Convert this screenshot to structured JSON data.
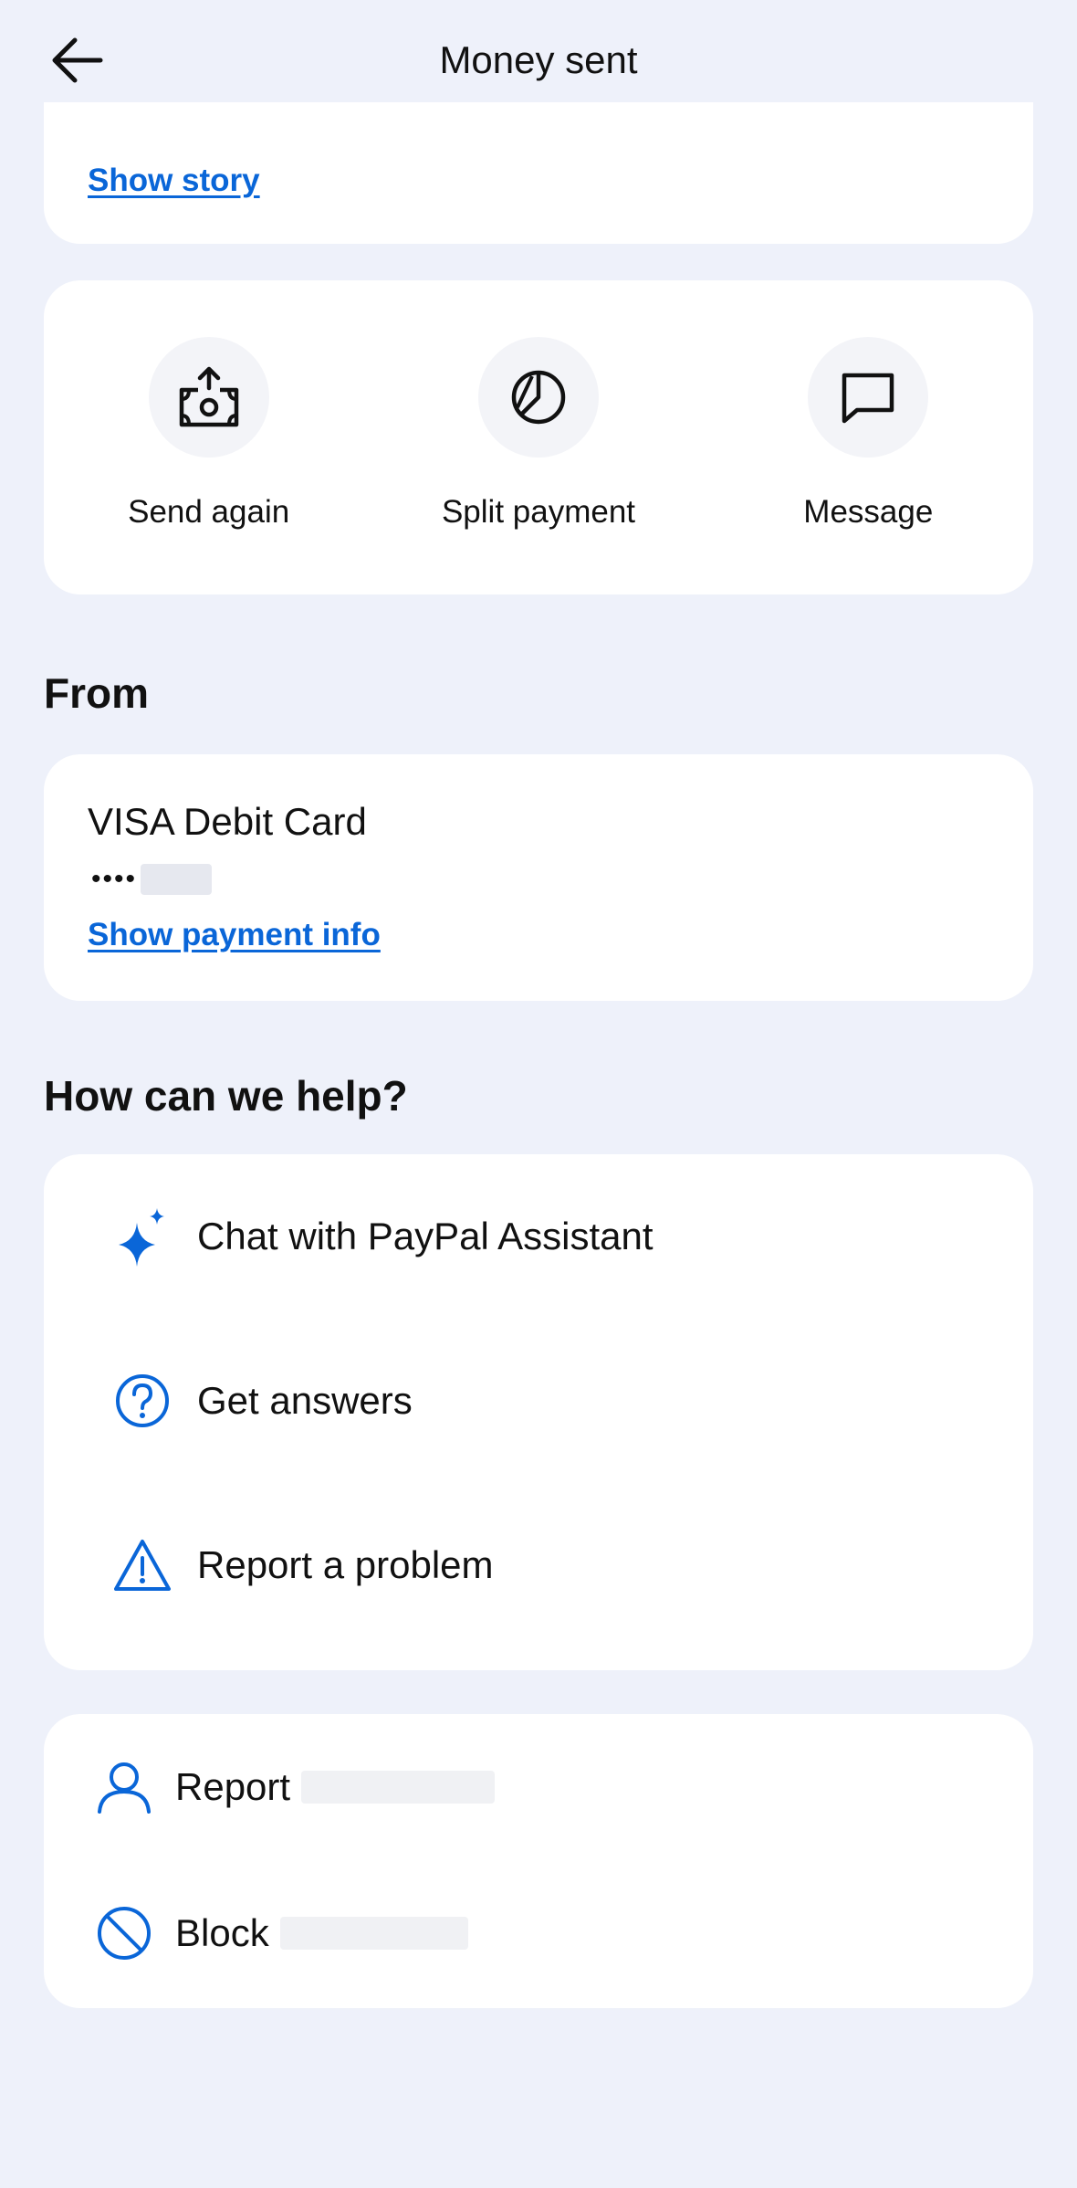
{
  "header": {
    "title": "Money sent",
    "back_icon": "arrow-left-icon"
  },
  "story": {
    "link": "Show story"
  },
  "actions": [
    {
      "label": "Send again",
      "icon": "send-money-icon"
    },
    {
      "label": "Split payment",
      "icon": "pie-chart-icon"
    },
    {
      "label": "Message",
      "icon": "message-icon"
    }
  ],
  "from": {
    "heading": "From",
    "card_name": "VISA Debit Card",
    "card_dots": "••••",
    "link": "Show payment info"
  },
  "help": {
    "heading": "How can we help?",
    "items": [
      {
        "label": "Chat with PayPal Assistant",
        "icon": "sparkle-icon"
      },
      {
        "label": "Get answers",
        "icon": "question-circle-icon"
      },
      {
        "label": "Report a problem",
        "icon": "warning-triangle-icon"
      }
    ]
  },
  "account_actions": {
    "report_label": "Report",
    "block_label": "Block"
  },
  "colors": {
    "accent": "#0a66d8",
    "background": "#eef1fa",
    "card": "#ffffff"
  }
}
